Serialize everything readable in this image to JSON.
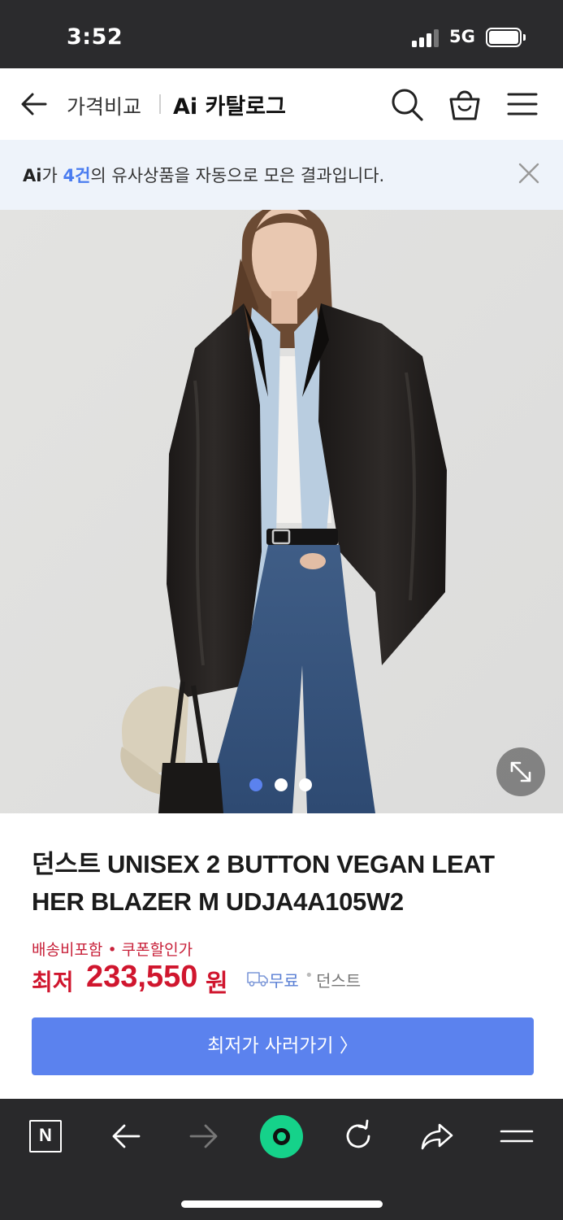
{
  "status_bar": {
    "time": "3:52",
    "network": "5G"
  },
  "header": {
    "back_icon": "arrow-left-icon",
    "breadcrumb": "가격비교",
    "title": "Ai 카탈로그",
    "icons": [
      "search-icon",
      "shopping-bag-icon",
      "hamburger-menu-icon"
    ]
  },
  "banner": {
    "ai_label": "Ai",
    "text_prefix": "가 ",
    "count": "4건",
    "text_suffix": "의 유사상품을 자동으로 모은 결과입니다.",
    "close_icon": "close-icon"
  },
  "gallery": {
    "current_index": 1,
    "total": 3,
    "active_dot_color": "#5b82ee",
    "expand_icon": "expand-diagonal-icon"
  },
  "product": {
    "name": "던스트 UNISEX 2 BUTTON VEGAN LEATHER BLAZER M UDJA4A105W2",
    "name_line1": "던스트 UNISEX 2 BUTTON VEGAN LEAT",
    "name_line2": "HER BLAZER M UDJA4A105W2",
    "price_note": "배송비포함 • 쿠폰할인가",
    "price_label": "최저",
    "price_value": "233,550",
    "price_unit": "원",
    "shipping": "무료",
    "seller": "던스트"
  },
  "buy_button": {
    "label": "최저가 사러가기 〉"
  },
  "toolbar": {
    "home_label": "N",
    "items": [
      "naver-home-icon",
      "back-arrow-icon",
      "forward-arrow-icon",
      "green-dot-icon",
      "refresh-icon",
      "share-icon",
      "menu-icon"
    ]
  },
  "colors": {
    "accent": "#5b82ee",
    "price": "#d0162e",
    "status_bg": "#2b2b2d",
    "banner_bg": "#eef3fa",
    "toolbar_bg": "#29292b",
    "green": "#15d28a"
  }
}
